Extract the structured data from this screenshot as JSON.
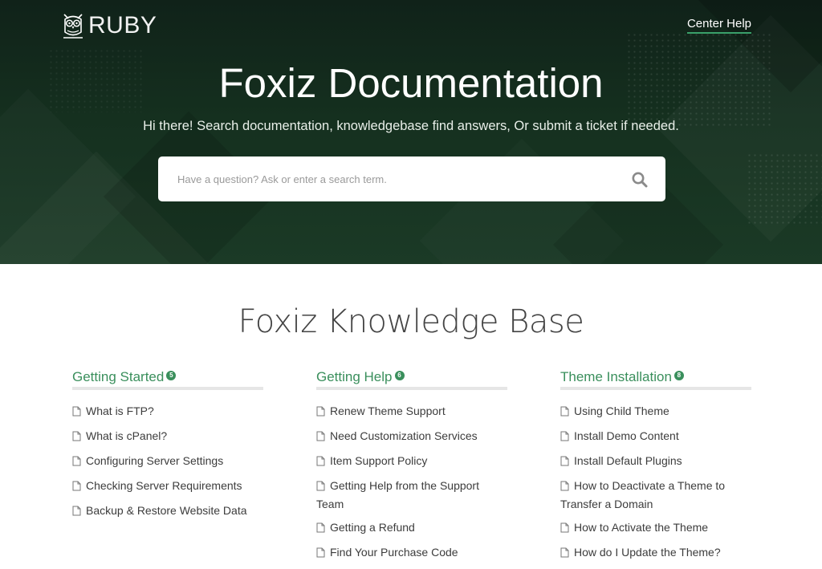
{
  "header": {
    "logo_text": "RUBY",
    "help_link": "Center Help"
  },
  "hero": {
    "title": "Foxiz Documentation",
    "subtitle": "Hi there! Search documentation, knowledgebase find answers, Or submit a ticket if needed.",
    "search_placeholder": "Have a question? Ask or enter a search term."
  },
  "knowledge_base": {
    "title": "Foxiz Knowledge Base",
    "accent_color": "#3a8f5c",
    "categories": [
      {
        "title": "Getting Started",
        "count": "5",
        "articles": [
          "What is FTP?",
          "What is cPanel?",
          "Configuring Server Settings",
          "Checking Server Requirements",
          "Backup & Restore Website Data"
        ]
      },
      {
        "title": "Getting Help",
        "count": "6",
        "articles": [
          "Renew Theme Support",
          "Need Customization Services",
          "Item Support Policy",
          "Getting Help from the Support Team",
          "Getting a Refund",
          "Find Your Purchase Code"
        ]
      },
      {
        "title": "Theme Installation",
        "count": "8",
        "articles": [
          "Using Child Theme",
          "Install Demo Content",
          "Install Default Plugins",
          "How to Deactivate a Theme to Transfer a Domain",
          "How to Activate the Theme",
          "How do I Update the Theme?"
        ]
      }
    ]
  }
}
